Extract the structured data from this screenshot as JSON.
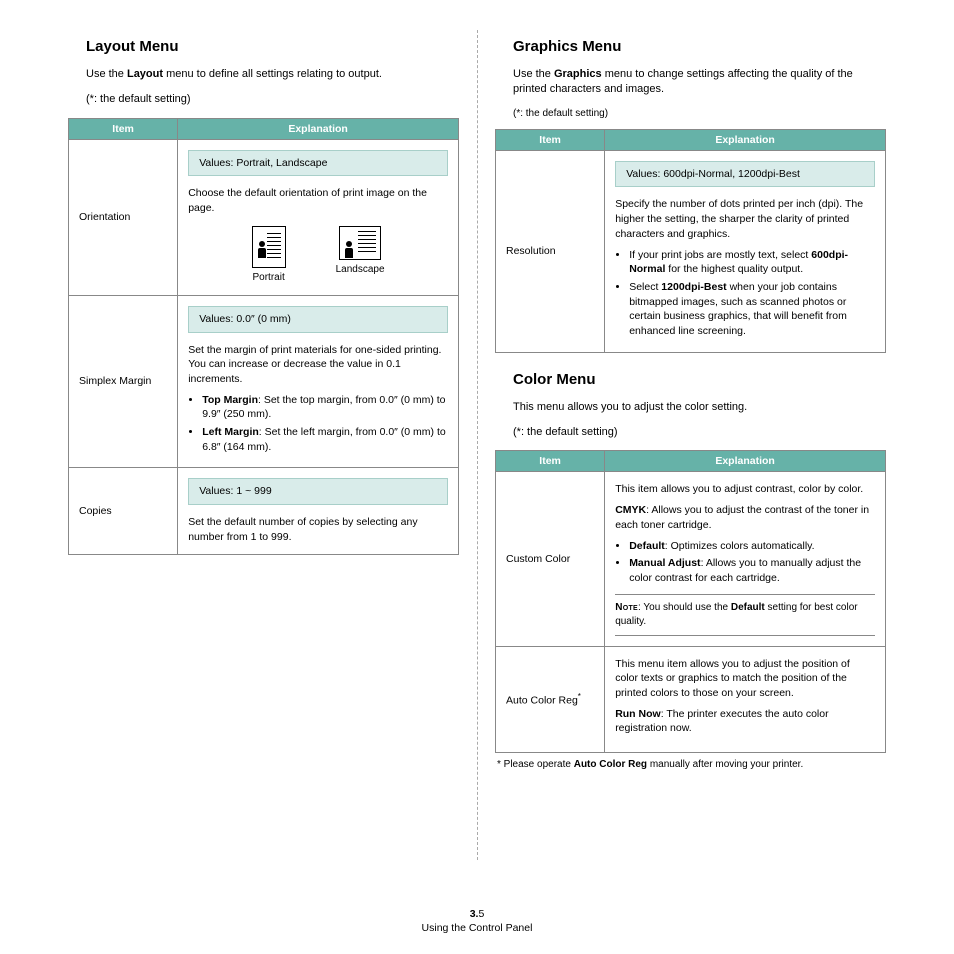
{
  "left": {
    "heading": "Layout Menu",
    "intro_pre": "Use the ",
    "intro_bold": "Layout",
    "intro_post": " menu to define all settings relating to output.",
    "default_note": "(*: the default setting)",
    "th_item": "Item",
    "th_expl": "Explanation",
    "rows": {
      "orientation": {
        "item": "Orientation",
        "values": "Values: Portrait, Landscape",
        "desc": "Choose the default orientation of print image on the page.",
        "portrait_label": "Portrait",
        "landscape_label": "Landscape"
      },
      "simplex": {
        "item": "Simplex Margin",
        "values": "Values: 0.0″ (0 mm)",
        "desc": "Set the margin of print materials for one-sided printing. You can increase or decrease the value in 0.1 increments.",
        "b1_label": "Top Margin",
        "b1_text": ": Set the top margin, from 0.0″ (0 mm) to 9.9″ (250 mm).",
        "b2_label": "Left Margin",
        "b2_text": ": Set the left margin, from 0.0″ (0 mm) to 6.8″ (164 mm)."
      },
      "copies": {
        "item": "Copies",
        "values": "Values: 1 ~ 999",
        "desc": "Set the default number of copies by selecting any number from 1 to 999."
      }
    }
  },
  "right": {
    "graphics": {
      "heading": "Graphics Menu",
      "intro_pre": "Use the ",
      "intro_bold": "Graphics",
      "intro_post": " menu to change settings affecting the quality of the printed characters and images.",
      "default_note": "(*: the default setting)",
      "th_item": "Item",
      "th_expl": "Explanation",
      "resolution": {
        "item": "Resolution",
        "values": "Values: 600dpi-Normal, 1200dpi-Best",
        "desc": "Specify the number of dots printed per inch (dpi). The higher the setting, the sharper the clarity of printed characters and graphics.",
        "b1_pre": "If your print jobs are mostly text, select ",
        "b1_bold": "600dpi-Normal",
        "b1_post": " for the highest quality output.",
        "b2_pre": "Select ",
        "b2_bold": "1200dpi-Best",
        "b2_post": " when your job contains bitmapped images, such as scanned photos or certain business graphics, that will benefit from enhanced line screening."
      }
    },
    "color": {
      "heading": "Color Menu",
      "intro": "This menu allows you to adjust the color setting.",
      "default_note": "(*: the default setting)",
      "th_item": "Item",
      "th_expl": "Explanation",
      "custom": {
        "item": "Custom Color",
        "p1": "This item allows you to adjust contrast, color by color.",
        "p2_bold": "CMYK",
        "p2_text": ": Allows you to adjust the contrast of the toner in each toner cartridge.",
        "b1_bold": "Default",
        "b1_text": ": Optimizes colors automatically.",
        "b2_bold": "Manual Adjust",
        "b2_text": ": Allows you to manually adjust the color contrast for each cartridge.",
        "note_label": "Note",
        "note_text_pre": ": You should use the ",
        "note_bold": "Default",
        "note_text_post": " setting for best color quality."
      },
      "auto": {
        "item": "Auto Color Reg",
        "sup": "*",
        "p1": "This menu item allows you to adjust the position of color texts or graphics to match the position of the printed colors to those on your screen.",
        "p2_bold": "Run Now",
        "p2_text": ": The printer executes the auto color registration now."
      },
      "footnote_pre": "*  Please operate ",
      "footnote_bold": "Auto Color Reg",
      "footnote_post": " manually after moving your printer."
    }
  },
  "footer": {
    "page_chapter": "3.",
    "page_num": "5",
    "caption": "Using the Control Panel"
  }
}
